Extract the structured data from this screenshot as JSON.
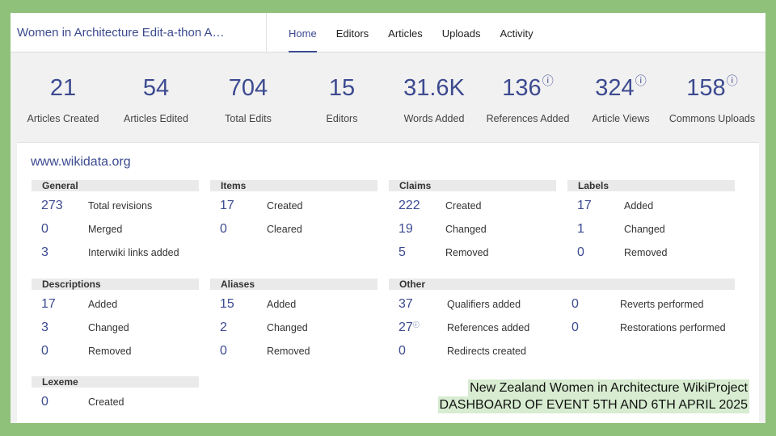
{
  "header": {
    "event_title": "Women in Architecture Edit-a-thon A…",
    "tabs": [
      {
        "label": "Home",
        "active": true
      },
      {
        "label": "Editors",
        "active": false
      },
      {
        "label": "Articles",
        "active": false
      },
      {
        "label": "Uploads",
        "active": false
      },
      {
        "label": "Activity",
        "active": false
      }
    ]
  },
  "stats": [
    {
      "value": "21",
      "label": "Articles Created"
    },
    {
      "value": "54",
      "label": "Articles Edited"
    },
    {
      "value": "704",
      "label": "Total Edits"
    },
    {
      "value": "15",
      "label": "Editors"
    },
    {
      "value": "31.6K",
      "label": "Words Added"
    },
    {
      "value": "136",
      "label": "References Added",
      "info": "ⓘ"
    },
    {
      "value": "324",
      "label": "Article Views",
      "info": "ⓘ"
    },
    {
      "value": "158",
      "label": "Commons Uploads",
      "info": "ⓘ"
    }
  ],
  "wikidata": {
    "title": "www.wikidata.org",
    "general": {
      "header": "General",
      "rows": [
        {
          "num": "273",
          "label": "Total revisions"
        },
        {
          "num": "0",
          "label": "Merged"
        },
        {
          "num": "3",
          "label": "Interwiki links added"
        }
      ]
    },
    "items": {
      "header": "Items",
      "rows": [
        {
          "num": "17",
          "label": "Created"
        },
        {
          "num": "0",
          "label": "Cleared"
        }
      ]
    },
    "claims": {
      "header": "Claims",
      "rows": [
        {
          "num": "222",
          "label": "Created"
        },
        {
          "num": "19",
          "label": "Changed"
        },
        {
          "num": "5",
          "label": "Removed"
        }
      ]
    },
    "labels": {
      "header": "Labels",
      "rows": [
        {
          "num": "17",
          "label": "Added"
        },
        {
          "num": "1",
          "label": "Changed"
        },
        {
          "num": "0",
          "label": "Removed"
        }
      ]
    },
    "descriptions": {
      "header": "Descriptions",
      "rows": [
        {
          "num": "17",
          "label": "Added"
        },
        {
          "num": "3",
          "label": "Changed"
        },
        {
          "num": "0",
          "label": "Removed"
        }
      ]
    },
    "aliases": {
      "header": "Aliases",
      "rows": [
        {
          "num": "15",
          "label": "Added"
        },
        {
          "num": "2",
          "label": "Changed"
        },
        {
          "num": "0",
          "label": "Removed"
        }
      ]
    },
    "other": {
      "header": "Other",
      "rows": [
        {
          "num": "37",
          "label": "Qualifiers added"
        },
        {
          "num": "27",
          "label": "References added",
          "info": "ⓘ"
        },
        {
          "num": "0",
          "label": "Redirects created"
        },
        {
          "num": "0",
          "label": "Reverts performed"
        },
        {
          "num": "0",
          "label": "Restorations performed"
        }
      ]
    },
    "lexeme": {
      "header": "Lexeme",
      "rows": [
        {
          "num": "0",
          "label": "Created"
        }
      ]
    }
  },
  "caption": {
    "line1": "New Zealand Women in Architecture WikiProject",
    "line2": "DASHBOARD OF EVENT 5TH AND 6TH APRIL 2025"
  },
  "colors": {
    "accent": "#3c4a90",
    "background": "#8fc17a",
    "caption_bg": "#d7ecd0"
  }
}
